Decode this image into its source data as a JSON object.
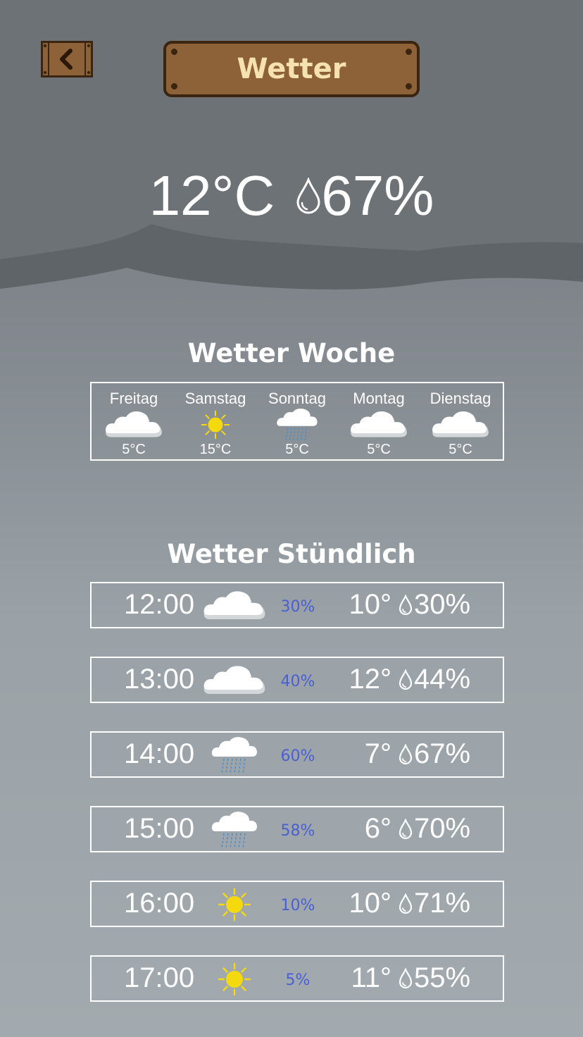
{
  "header": {
    "title": "Wetter",
    "back_icon": "back-arrow-icon"
  },
  "current": {
    "temperature": "12°C",
    "humidity": "67%"
  },
  "week": {
    "title": "Wetter Woche",
    "days": [
      {
        "name": "Freitag",
        "icon": "cloud-icon",
        "temp": "5°C"
      },
      {
        "name": "Samstag",
        "icon": "sun-icon",
        "temp": "15°C"
      },
      {
        "name": "Sonntag",
        "icon": "rain-cloud-icon",
        "temp": "5°C"
      },
      {
        "name": "Montag",
        "icon": "cloud-icon",
        "temp": "5°C"
      },
      {
        "name": "Dienstag",
        "icon": "cloud-icon",
        "temp": "5°C"
      }
    ]
  },
  "hourly": {
    "title": "Wetter Stündlich",
    "rows": [
      {
        "time": "12:00",
        "icon": "cloud-icon",
        "rain_chance": "30%",
        "temp": "10°",
        "humidity": "30%"
      },
      {
        "time": "13:00",
        "icon": "cloud-icon",
        "rain_chance": "40%",
        "temp": "12°",
        "humidity": "44%"
      },
      {
        "time": "14:00",
        "icon": "rain-cloud-icon",
        "rain_chance": "60%",
        "temp": "7°",
        "humidity": "67%"
      },
      {
        "time": "15:00",
        "icon": "rain-cloud-icon",
        "rain_chance": "58%",
        "temp": "6°",
        "humidity": "70%"
      },
      {
        "time": "16:00",
        "icon": "sun-icon",
        "rain_chance": "10%",
        "temp": "10°",
        "humidity": "71%"
      },
      {
        "time": "17:00",
        "icon": "sun-icon",
        "rain_chance": "5%",
        "temp": "11°",
        "humidity": "55%"
      }
    ]
  },
  "colors": {
    "plank": "#8e6238",
    "plank_border": "#3b2410",
    "title_text": "#f6e2b0",
    "rain_chance": "#4a5fd0",
    "sun": "#f5d90f",
    "corner_accent": "#c6d12a"
  }
}
